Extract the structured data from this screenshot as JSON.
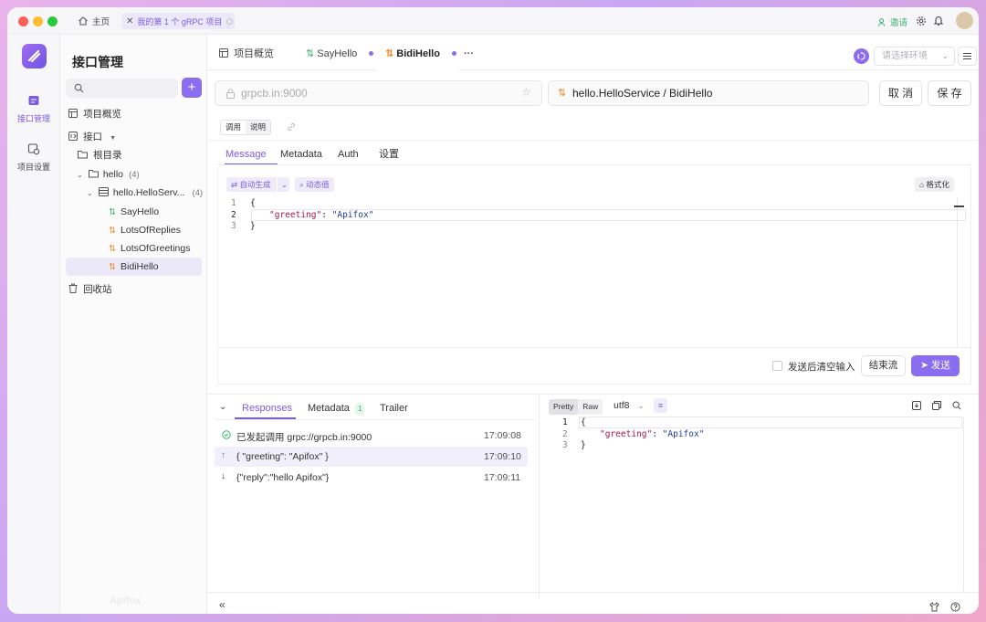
{
  "window": {
    "home_label": "主页",
    "active_tab_label": "我的第 1 个 gRPC 项目",
    "invite_label": "邀请"
  },
  "rail": {
    "items": [
      {
        "label": "接口管理"
      },
      {
        "label": "项目设置"
      }
    ]
  },
  "sidebar": {
    "title": "接口管理",
    "search_placeholder": "",
    "add_label": "+",
    "overview_label": "项目概览",
    "interfaces_label": "接口",
    "root_label": "根目录",
    "hello_label": "hello",
    "hello_count": "(4)",
    "service_label": "hello.HelloServ...",
    "service_count": "(4)",
    "methods": [
      {
        "label": "SayHello"
      },
      {
        "label": "LotsOfReplies"
      },
      {
        "label": "LotsOfGreetings"
      },
      {
        "label": "BidiHello"
      }
    ],
    "trash_label": "回收站",
    "watermark": "Apifox"
  },
  "tabs": {
    "overview": "项目概览",
    "sayhello": "SayHello",
    "bidihello": "BidiHello",
    "more": "···",
    "env_placeholder": "请选择环境"
  },
  "request": {
    "url": "grpcb.in:9000",
    "service_path": "hello.HelloService / BidiHello",
    "cancel_label": "取 消",
    "save_label": "保 存",
    "mode_tabs": [
      "调用",
      "说明"
    ],
    "sub_tabs": [
      "Message",
      "Metadata",
      "Auth",
      "设置"
    ],
    "auto_generate_label": "自动生成",
    "dynamic_value_label": "动态值",
    "format_label": "格式化",
    "editor_lines": [
      {
        "no": "1",
        "text": "{"
      },
      {
        "no": "2",
        "key": "\"greeting\"",
        "sep": ": ",
        "val": "\"Apifox\""
      },
      {
        "no": "3",
        "text": "}"
      }
    ],
    "clear_after_send_label": "发送后清空输入",
    "end_stream_label": "结束流",
    "send_label": "发送"
  },
  "response": {
    "tabs": [
      "Responses",
      "Metadata",
      "Trailer"
    ],
    "metadata_count": "1",
    "messages": [
      {
        "text": "已发起调用 grpc://grpcb.in:9000",
        "time": "17:09:08"
      },
      {
        "text": "{ \"greeting\": \"Apifox\" }",
        "time": "17:09:10"
      },
      {
        "text": "{\"reply\":\"hello Apifox\"}",
        "time": "17:09:11"
      }
    ],
    "view_modes": [
      "Pretty",
      "Raw"
    ],
    "encoding": "utf8",
    "viewer_lines": [
      {
        "no": "1",
        "text": "{"
      },
      {
        "no": "2",
        "key": "\"greeting\"",
        "sep": ": ",
        "val": "\"Apifox\""
      },
      {
        "no": "3",
        "text": "}"
      }
    ]
  },
  "colors": {
    "accent": "#7c5ce0",
    "orange": "#f08a24",
    "green": "#3bb273"
  }
}
